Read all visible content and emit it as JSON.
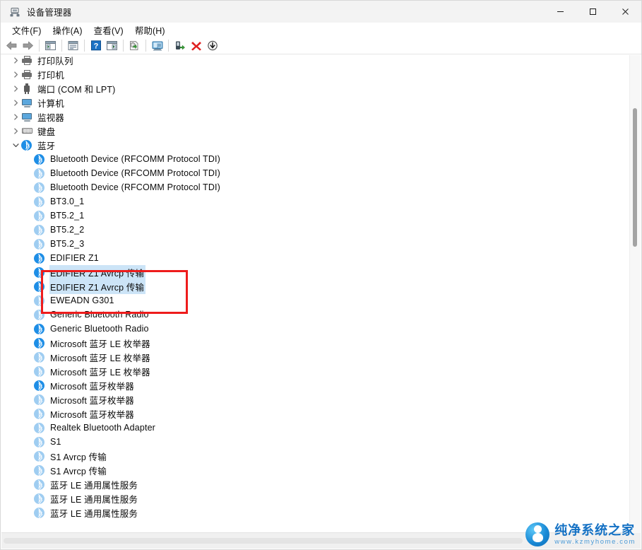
{
  "window": {
    "title": "设备管理器",
    "icon": "device-manager-icon",
    "controls": {
      "minimize": "—",
      "maximize": "□",
      "close": "✕"
    }
  },
  "menubar": {
    "items": [
      {
        "label": "文件(F)",
        "name": "menu-file"
      },
      {
        "label": "操作(A)",
        "name": "menu-action"
      },
      {
        "label": "查看(V)",
        "name": "menu-view"
      },
      {
        "label": "帮助(H)",
        "name": "menu-help"
      }
    ]
  },
  "toolbar": {
    "buttons": [
      {
        "name": "back-button",
        "icon": "back-arrow-icon"
      },
      {
        "name": "forward-button",
        "icon": "forward-arrow-icon"
      },
      {
        "sep": true
      },
      {
        "name": "show-hide-console-tree-button",
        "icon": "console-tree-icon"
      },
      {
        "sep": true
      },
      {
        "name": "properties-button",
        "icon": "properties-icon"
      },
      {
        "sep": true
      },
      {
        "name": "help-button",
        "icon": "help-question-icon"
      },
      {
        "name": "show-hide-action-pane-button",
        "icon": "action-pane-icon"
      },
      {
        "sep": true
      },
      {
        "name": "update-driver-button",
        "icon": "update-driver-icon"
      },
      {
        "sep": true
      },
      {
        "name": "scan-hardware-changes-button",
        "icon": "scan-hardware-icon"
      },
      {
        "sep": true
      },
      {
        "name": "enable-device-button",
        "icon": "enable-device-icon"
      },
      {
        "name": "uninstall-device-button",
        "icon": "uninstall-red-x-icon"
      },
      {
        "name": "disable-device-button",
        "icon": "disable-down-arrow-icon"
      }
    ]
  },
  "tree": {
    "categories": [
      {
        "label": "打印队列",
        "icon": "printer-icon",
        "expanded": false
      },
      {
        "label": "打印机",
        "icon": "printer-icon",
        "expanded": false
      },
      {
        "label": "端口 (COM 和 LPT)",
        "icon": "port-icon",
        "expanded": false
      },
      {
        "label": "计算机",
        "icon": "computer-monitor-icon",
        "expanded": false
      },
      {
        "label": "监视器",
        "icon": "monitor-icon",
        "expanded": false
      },
      {
        "label": "键盘",
        "icon": "keyboard-icon",
        "expanded": false
      },
      {
        "label": "蓝牙",
        "icon": "bluetooth-icon",
        "expanded": true
      }
    ],
    "bluetooth_devices": [
      {
        "label": "Bluetooth Device (RFCOMM Protocol TDI)",
        "icon": "bluetooth-icon",
        "state": "active",
        "selected": false,
        "boxed": false
      },
      {
        "label": "Bluetooth Device (RFCOMM Protocol TDI)",
        "icon": "bluetooth-icon",
        "state": "inactive",
        "selected": false,
        "boxed": false
      },
      {
        "label": "Bluetooth Device (RFCOMM Protocol TDI)",
        "icon": "bluetooth-icon",
        "state": "inactive",
        "selected": false,
        "boxed": false
      },
      {
        "label": "BT3.0_1",
        "icon": "bluetooth-icon",
        "state": "inactive",
        "selected": false,
        "boxed": false
      },
      {
        "label": "BT5.2_1",
        "icon": "bluetooth-icon",
        "state": "inactive",
        "selected": false,
        "boxed": false
      },
      {
        "label": "BT5.2_2",
        "icon": "bluetooth-icon",
        "state": "inactive",
        "selected": false,
        "boxed": false
      },
      {
        "label": "BT5.2_3",
        "icon": "bluetooth-icon",
        "state": "inactive",
        "selected": false,
        "boxed": false
      },
      {
        "label": "EDIFIER Z1",
        "icon": "bluetooth-icon",
        "state": "active",
        "selected": false,
        "boxed": true
      },
      {
        "label": "EDIFIER Z1 Avrcp 传输",
        "icon": "bluetooth-icon",
        "state": "active",
        "selected": true,
        "boxed": true
      },
      {
        "label": "EDIFIER Z1 Avrcp 传输",
        "icon": "bluetooth-icon",
        "state": "active",
        "selected": true,
        "boxed": true
      },
      {
        "label": "EWEADN G301",
        "icon": "bluetooth-icon",
        "state": "inactive",
        "selected": false,
        "boxed": false
      },
      {
        "label": "Generic Bluetooth Radio",
        "icon": "bluetooth-icon",
        "state": "inactive",
        "selected": false,
        "boxed": false
      },
      {
        "label": "Generic Bluetooth Radio",
        "icon": "bluetooth-icon",
        "state": "active",
        "selected": false,
        "boxed": false
      },
      {
        "label": "Microsoft 蓝牙 LE 枚举器",
        "icon": "bluetooth-icon",
        "state": "active",
        "selected": false,
        "boxed": false
      },
      {
        "label": "Microsoft 蓝牙 LE 枚举器",
        "icon": "bluetooth-icon",
        "state": "inactive",
        "selected": false,
        "boxed": false
      },
      {
        "label": "Microsoft 蓝牙 LE 枚举器",
        "icon": "bluetooth-icon",
        "state": "inactive",
        "selected": false,
        "boxed": false
      },
      {
        "label": "Microsoft 蓝牙枚举器",
        "icon": "bluetooth-icon",
        "state": "active",
        "selected": false,
        "boxed": false
      },
      {
        "label": "Microsoft 蓝牙枚举器",
        "icon": "bluetooth-icon",
        "state": "inactive",
        "selected": false,
        "boxed": false
      },
      {
        "label": "Microsoft 蓝牙枚举器",
        "icon": "bluetooth-icon",
        "state": "inactive",
        "selected": false,
        "boxed": false
      },
      {
        "label": "Realtek Bluetooth Adapter",
        "icon": "bluetooth-icon",
        "state": "inactive",
        "selected": false,
        "boxed": false
      },
      {
        "label": "S1",
        "icon": "bluetooth-icon",
        "state": "inactive",
        "selected": false,
        "boxed": false
      },
      {
        "label": "S1 Avrcp 传输",
        "icon": "bluetooth-icon",
        "state": "inactive",
        "selected": false,
        "boxed": false
      },
      {
        "label": "S1 Avrcp 传输",
        "icon": "bluetooth-icon",
        "state": "inactive",
        "selected": false,
        "boxed": false
      },
      {
        "label": "蓝牙 LE 通用属性服务",
        "icon": "bluetooth-icon",
        "state": "inactive",
        "selected": false,
        "boxed": false
      },
      {
        "label": "蓝牙 LE 通用属性服务",
        "icon": "bluetooth-icon",
        "state": "inactive",
        "selected": false,
        "boxed": false
      },
      {
        "label": "蓝牙 LE 通用属性服务",
        "icon": "bluetooth-icon",
        "state": "inactive",
        "selected": false,
        "boxed": false
      }
    ]
  },
  "annotation": {
    "color": "#ee1c1c",
    "label": "edifier-z1-highlight-box"
  },
  "colors": {
    "bluetooth_active": "#1e8ee6",
    "bluetooth_inactive": "#9fcdf1",
    "selection": "#cce4f7",
    "annotation_red": "#ee1c1c",
    "watermark_blue": "#1471c4"
  },
  "watermark": {
    "title": "纯净系统之家",
    "url": "www.kzmyhome.com"
  }
}
